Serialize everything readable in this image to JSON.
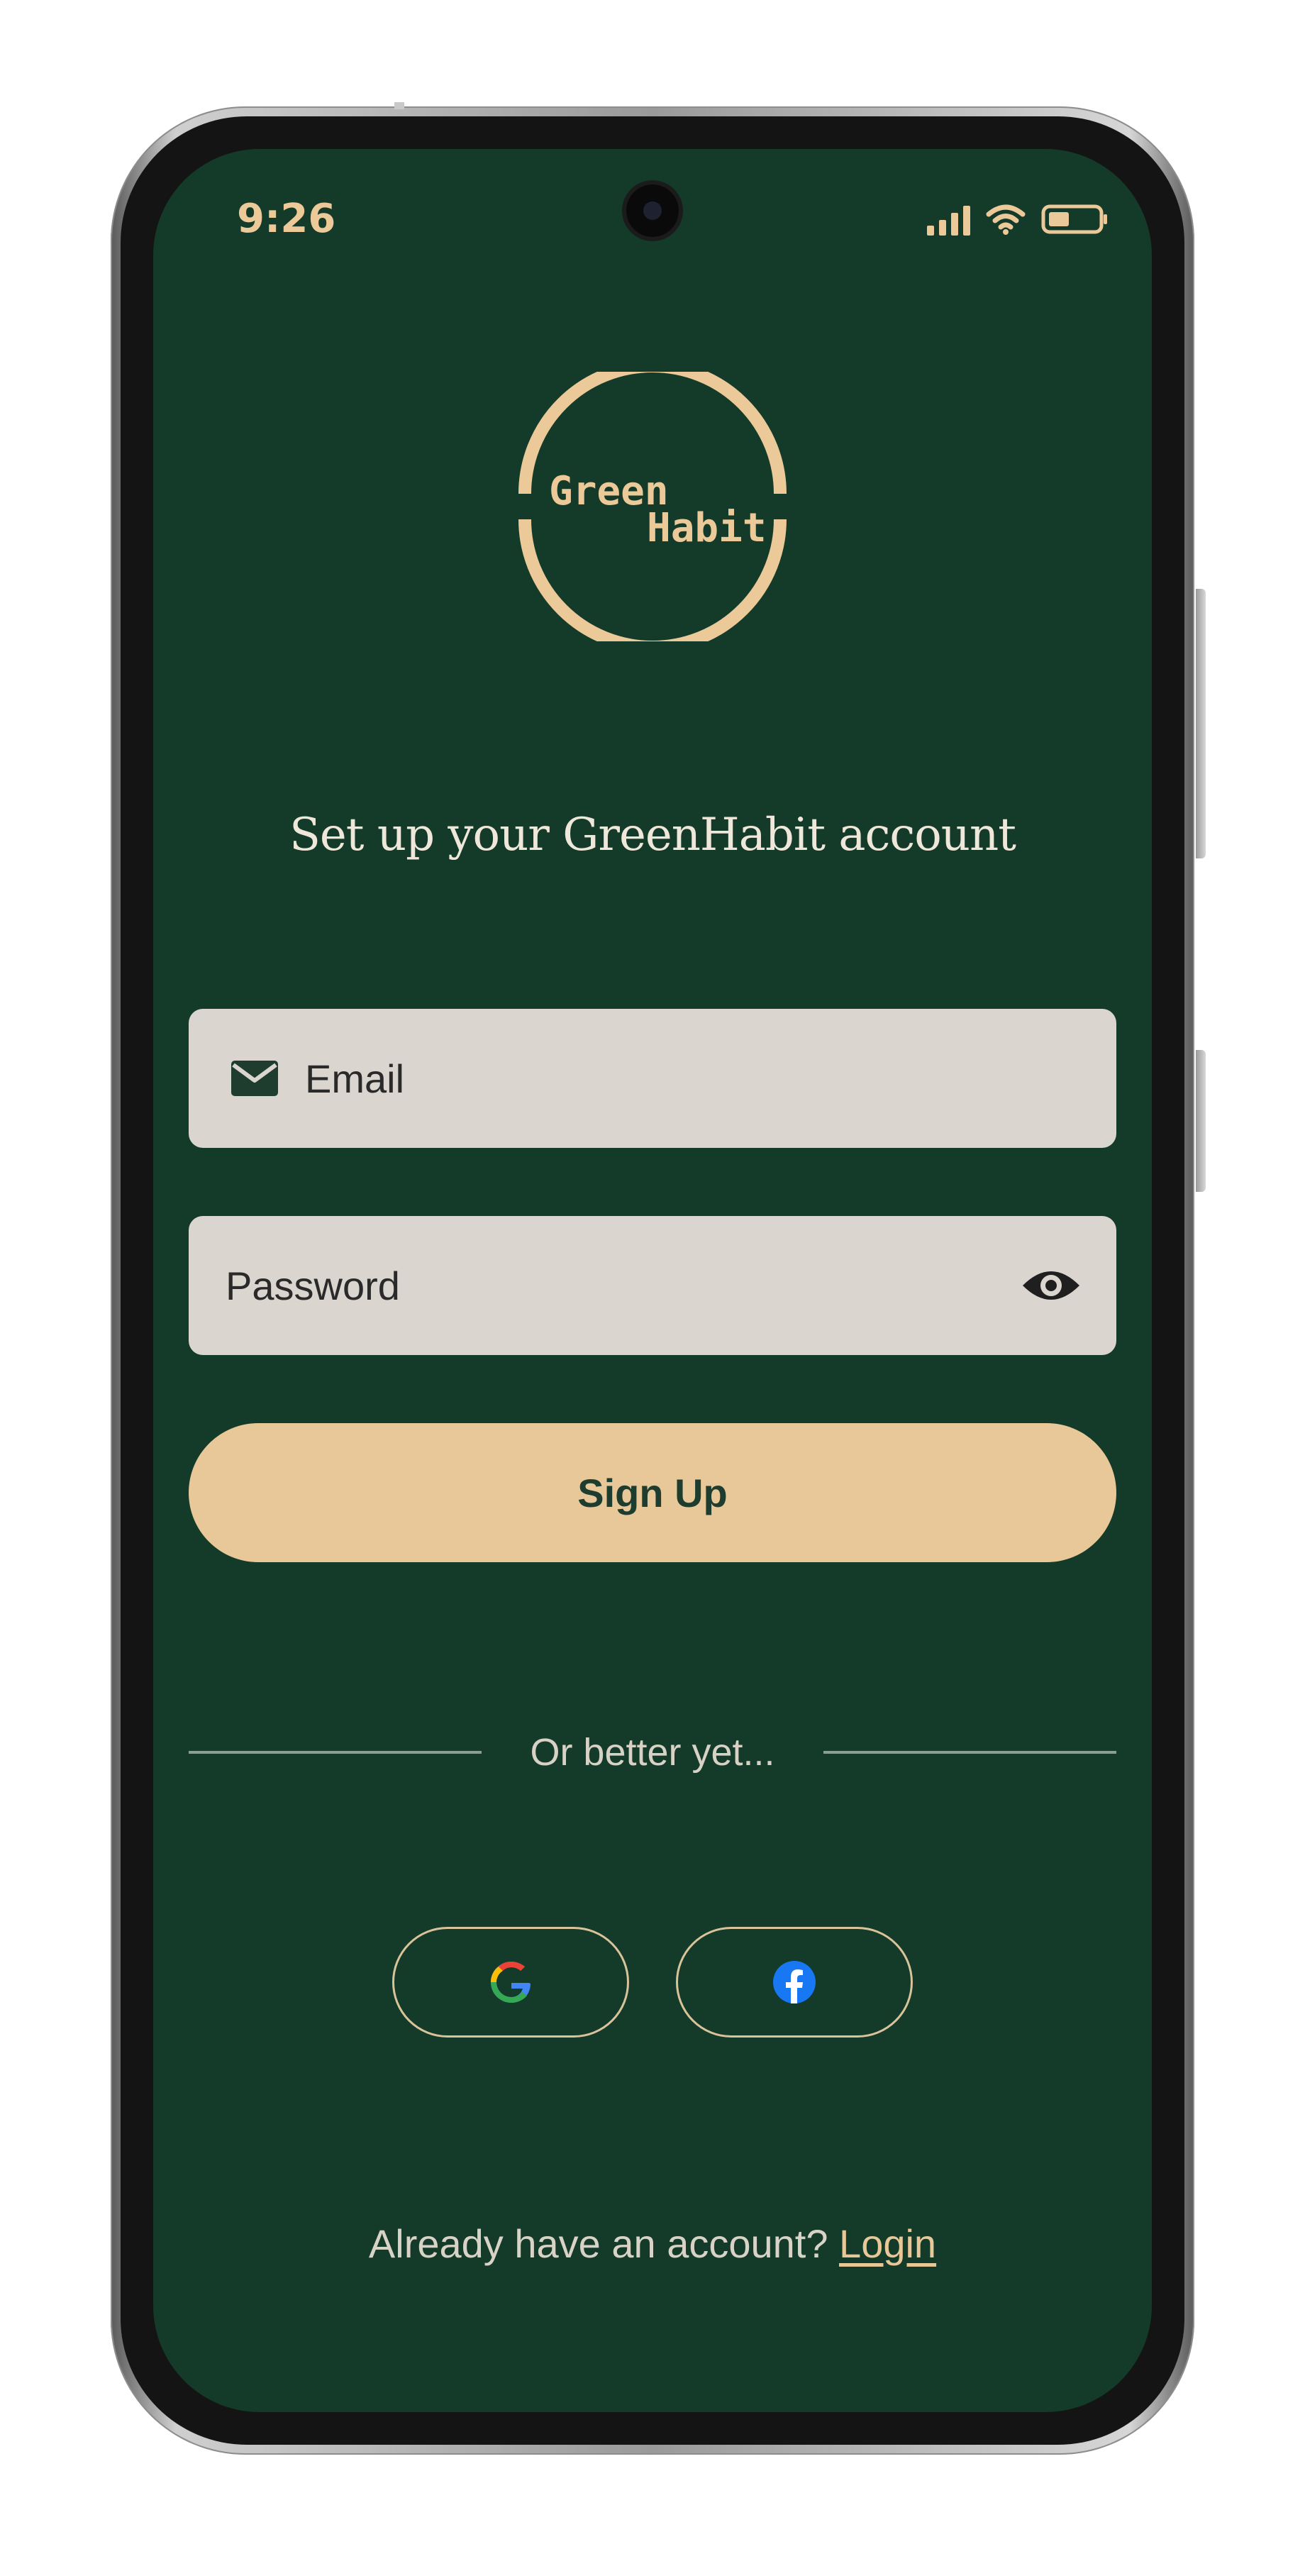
{
  "status_bar": {
    "time": "9:26",
    "icons": [
      "signal-icon",
      "wifi-icon",
      "battery-icon"
    ]
  },
  "logo": {
    "line1": "Green",
    "line2": "Habit"
  },
  "heading": "Set up your GreenHabit account",
  "form": {
    "email": {
      "placeholder": "Email",
      "icon": "mail-icon"
    },
    "password": {
      "placeholder": "Password",
      "icon": "eye-icon"
    },
    "signup_label": "Sign Up"
  },
  "divider_label": "Or better yet...",
  "social": [
    {
      "provider": "Google",
      "icon": "google-icon"
    },
    {
      "provider": "Facebook",
      "icon": "facebook-icon"
    }
  ],
  "footer": {
    "prompt": "Already have an account?",
    "login_label": "Login"
  },
  "colors": {
    "background": "#143a29",
    "accent": "#e8c898",
    "field": "#dbd5cf"
  }
}
